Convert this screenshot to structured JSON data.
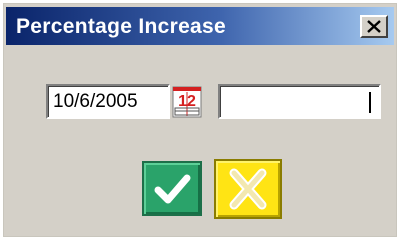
{
  "dialog": {
    "title": "Percentage Increase",
    "close_icon": "close-icon"
  },
  "form": {
    "date_value": "10/6/2005",
    "calendar_icon": "calendar-icon",
    "calendar_icon_text": "12",
    "percent_value": ""
  },
  "buttons": {
    "ok_icon": "checkmark-icon",
    "cancel_icon": "cross-icon"
  },
  "colors": {
    "titlebar_start": "#0a246a",
    "titlebar_end": "#a6caf0",
    "ok_green": "#2aa36a",
    "cancel_yellow": "#ffe414",
    "calendar_red": "#d42020"
  }
}
